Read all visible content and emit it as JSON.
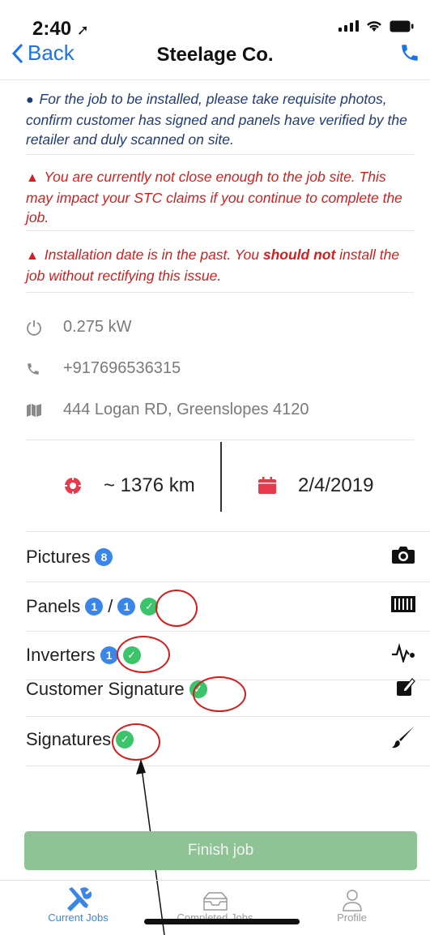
{
  "status": {
    "time": "2:40"
  },
  "nav": {
    "back_label": "Back",
    "title": "Steelage Co."
  },
  "notices": {
    "info": "For the job to be installed, please take requisite photos, confirm customer has signed and panels have verified by the retailer and duly scanned on site.",
    "proximity": "You are currently not close enough to the job site. This may impact your STC claims if you continue to complete the job.",
    "date_pre": "Installation date is in the past. You ",
    "date_bold": "should not",
    "date_post": " install the job without rectifying this issue."
  },
  "job": {
    "power": "0.275 kW",
    "phone": "+917696536315",
    "address": "444 Logan RD, Greenslopes 4120",
    "distance": "~ 1376 km",
    "date": "2/4/2019"
  },
  "items": {
    "pictures": {
      "label": "Pictures",
      "badge": "8"
    },
    "panels": {
      "label": "Panels",
      "badge1": "1",
      "sep": "/",
      "badge2": "1"
    },
    "inverters": {
      "label": "Inverters",
      "badge": "1"
    },
    "customer_signature": {
      "label": "Customer Signature"
    },
    "signatures": {
      "label": "Signatures"
    }
  },
  "finish_button": "Finish job",
  "tabs": [
    {
      "label": "Current Jobs",
      "icon": "tools-icon"
    },
    {
      "label": "Completed Jobs",
      "icon": "inbox-icon"
    },
    {
      "label": "Profile",
      "icon": "user-icon"
    }
  ],
  "colors": {
    "accent": "#3a86e8",
    "warning": "#d21f1f",
    "success": "#3cc46a",
    "finish_disabled": "#8fc396"
  }
}
